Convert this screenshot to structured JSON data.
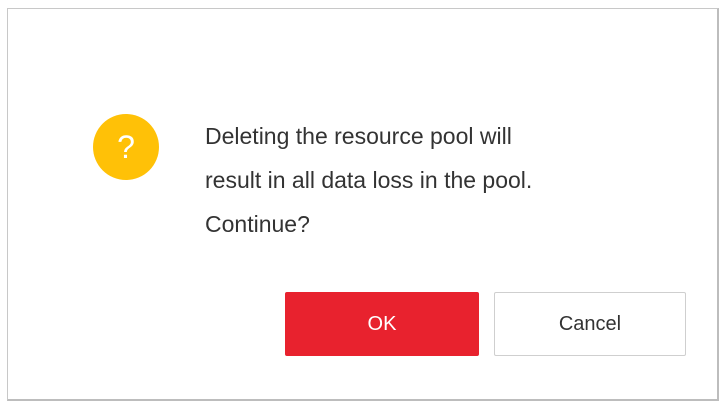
{
  "dialog": {
    "icon": "question-icon",
    "icon_glyph": "?",
    "icon_color": "#ffc107",
    "message_lines": [
      "Deleting the resource pool will",
      "result in all data loss in the pool.",
      "Continue?"
    ],
    "ok_label": "OK",
    "cancel_label": "Cancel",
    "ok_color": "#e8222e"
  }
}
